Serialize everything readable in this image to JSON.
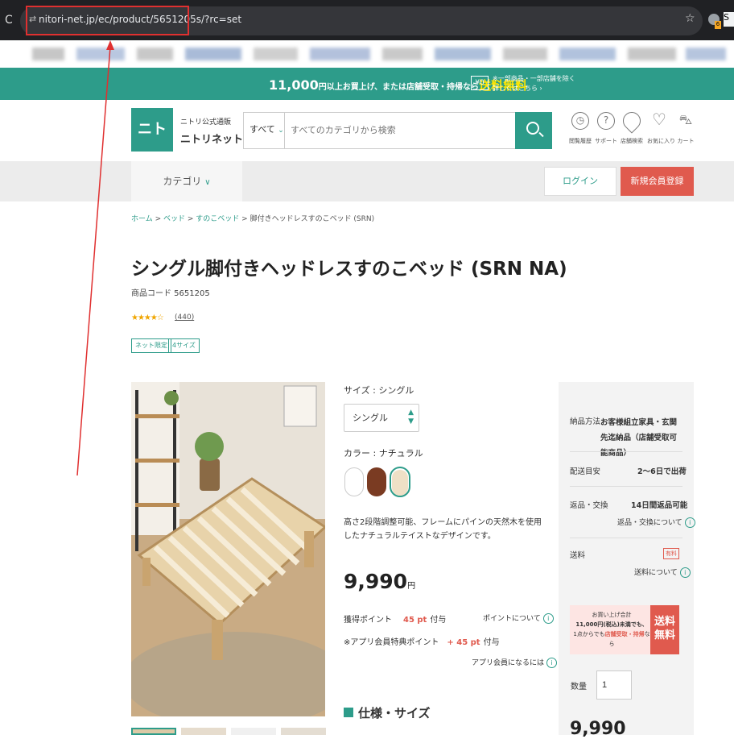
{
  "browser": {
    "url": "nitori-net.jp/ec/product/5651205s/?rc=set",
    "ext_badge": "6",
    "ext_letter": "S"
  },
  "promo": {
    "main_prefix": "11,000",
    "main_mid": "円以上お買上げ、または店舗受取・持帰なら",
    "main_free": "送料無料",
    "zero": "¥0",
    "note_line1": "※一部商品・一部店舗を除く",
    "note_line2": "詳しくはこちら ›"
  },
  "header": {
    "logo_text": "ニトリ",
    "logo_sub": "ニトリ公式通販",
    "logo_main": "ニトリネット",
    "search_category": "すべて",
    "search_placeholder": "すべてのカテゴリから検索",
    "icons": [
      {
        "name": "browsing-history-icon",
        "glyph": "🕓",
        "label": "閲覧履歴"
      },
      {
        "name": "support-icon",
        "glyph": "?",
        "label": "サポート"
      },
      {
        "name": "store-search-icon",
        "glyph": "📍",
        "label": "店舗検索"
      },
      {
        "name": "favorites-icon",
        "glyph": "♡",
        "label": "お気に入り"
      },
      {
        "name": "cart-icon",
        "glyph": "🛒",
        "label": "カート"
      }
    ]
  },
  "nav": {
    "category": "カテゴリ",
    "login": "ログイン",
    "register": "新規会員登録"
  },
  "breadcrumb": {
    "home": "ホーム",
    "bed": "ベッド",
    "sunoko": "すのこベッド",
    "current": "脚付きヘッドレスすのこベッド (SRN)",
    "sep": " > "
  },
  "product": {
    "title": "シングル脚付きヘッドレスすのこベッド (SRN NA)",
    "code": "商品コード 5651205",
    "rating": 4,
    "stars": "★★★★☆",
    "review_count": "(440)",
    "tags": [
      "ネット限定",
      "4サイズ"
    ],
    "size_label": "サイズ : シングル",
    "size_value": "シングル",
    "color_label": "カラー : ナチュラル",
    "colors": [
      "#ffffff",
      "#7a3b22",
      "#efe0c6"
    ],
    "description": "高さ2段階調整可能、フレームにパインの天然木を使用したナチュラルテイストなデザインです。",
    "price": "9,990",
    "price_unit": "円",
    "points_label": "獲得ポイント",
    "points_value": "45 pt",
    "points_suffix": "付与",
    "points_link": "ポイントについて",
    "app_label": "※アプリ会員特典ポイント",
    "app_value": "+ 45 pt",
    "app_suffix": "付与",
    "app_link": "アプリ会員になるには",
    "spec_heading": "仕様・サイズ"
  },
  "side": {
    "delivery_method_label": "納品方法",
    "delivery_method_value": "お客様組立家具・玄関先迄納品（店舗受取可能商品）",
    "delivery_date_label": "配送目安",
    "delivery_date_value": "2〜6日で出荷",
    "return_label": "返品・交換",
    "return_value": "14日間返品可能",
    "return_link": "返品・交換について",
    "shipping_label": "送料",
    "shipping_tag": "有料",
    "shipping_link": "送料について",
    "free_line1": "お買い上げ合計",
    "free_line2": "11,000円(税込)未満でも、",
    "free_line3_pre": "1点からでも",
    "free_line3_em": "店舗受取・持帰",
    "free_line3_post": "なら",
    "free_badge": "送料無料",
    "qty_label": "数量",
    "qty_value": "1",
    "price": "9,990"
  }
}
